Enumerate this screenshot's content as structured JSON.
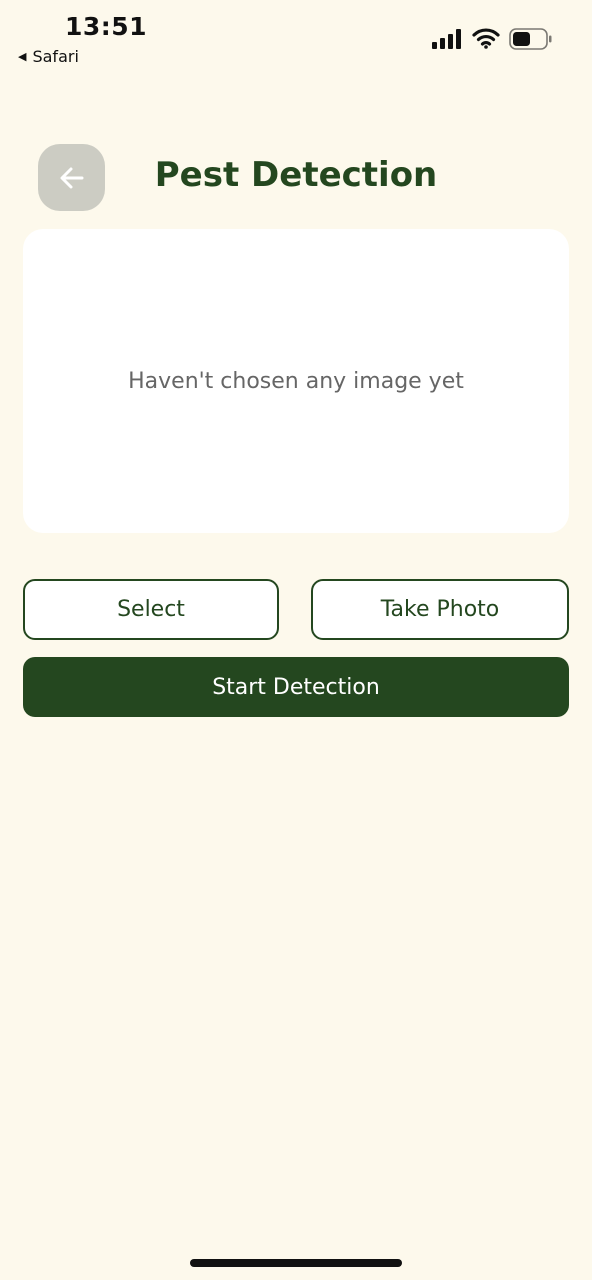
{
  "status_bar": {
    "time": "13:51",
    "back_app_label": "Safari",
    "icons": [
      "cellular-signal-icon",
      "wifi-icon",
      "battery-icon"
    ]
  },
  "header": {
    "back_icon": "arrow-left-icon",
    "title": "Pest Detection"
  },
  "preview": {
    "placeholder": "Haven't chosen any image yet"
  },
  "actions": {
    "select_label": "Select",
    "take_photo_label": "Take Photo",
    "start_label": "Start Detection"
  },
  "colors": {
    "background": "#FDF9EC",
    "primary": "#24471F",
    "back_button_bg": "#CCCCC3",
    "placeholder_text": "#666666",
    "card": "#FFFFFF"
  }
}
